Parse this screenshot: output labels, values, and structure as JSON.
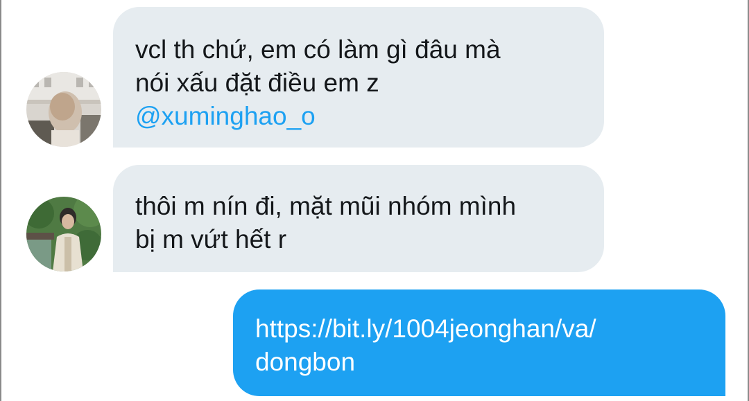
{
  "conversation": {
    "messages": [
      {
        "direction": "incoming",
        "avatar": "user-avatar-photo",
        "lines": [
          "vcl th chứ, em có làm gì đâu mà",
          "nói xấu đặt điều em z"
        ],
        "mention": "@xuminghao_o"
      },
      {
        "direction": "incoming",
        "avatar": "user-avatar-photo",
        "lines": [
          "thôi m nín đi, mặt mũi nhóm mình",
          "bị m vứt hết r"
        ]
      },
      {
        "direction": "outgoing",
        "lines": [
          "https://bit.ly/1004jeonghan/va/",
          "dongbon"
        ]
      }
    ]
  },
  "colors": {
    "incoming_bubble": "#e6ecf0",
    "outgoing_bubble": "#1da1f2",
    "mention": "#1da1f2",
    "text": "#14171a",
    "background": "#ffffff"
  }
}
